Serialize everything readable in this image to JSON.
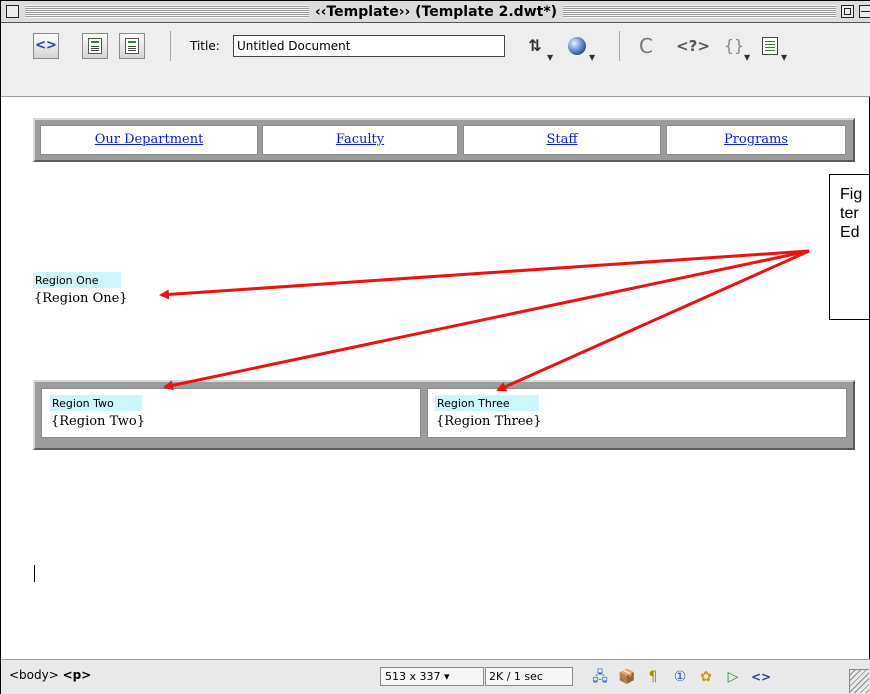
{
  "window": {
    "title": "‹‹Template›› (Template 2.dwt*)"
  },
  "toolbar": {
    "code_view_icon": "code-brackets-icon",
    "split_view_icon": "split-view-icon",
    "design_view_icon": "design-view-icon",
    "title_label": "Title:",
    "title_value": "Untitled Document",
    "code_view_glyph": "<>",
    "transfer_glyph": "⇅",
    "refresh_glyph": "C",
    "reference_glyph": "<?>",
    "code_nav_glyph": "{}"
  },
  "nav": {
    "links": [
      "Our Department",
      "Faculty",
      "Staff",
      "Programs"
    ]
  },
  "regions": {
    "one": {
      "tag": "Region One",
      "placeholder": "{Region One}"
    },
    "two": {
      "tag": "Region Two",
      "placeholder": "{Region Two}"
    },
    "three": {
      "tag": "Region Three",
      "placeholder": "{Region Three}"
    }
  },
  "callout": {
    "lines": [
      "Fig",
      "ter",
      "Ed"
    ]
  },
  "statusbar": {
    "tag_body": "<body>",
    "tag_p": "<p>",
    "window_size": "513 x 337 ▾",
    "download": "2K / 1 sec",
    "launcher_glyphs": [
      "🖧",
      "📦",
      "¶",
      "①",
      "✿",
      "▷",
      "<>"
    ]
  },
  "colors": {
    "link": "#0a1fcf",
    "region_highlight": "#ccf6fa",
    "arrow": "#ee1111",
    "frame_gray": "#9c9c9c"
  }
}
